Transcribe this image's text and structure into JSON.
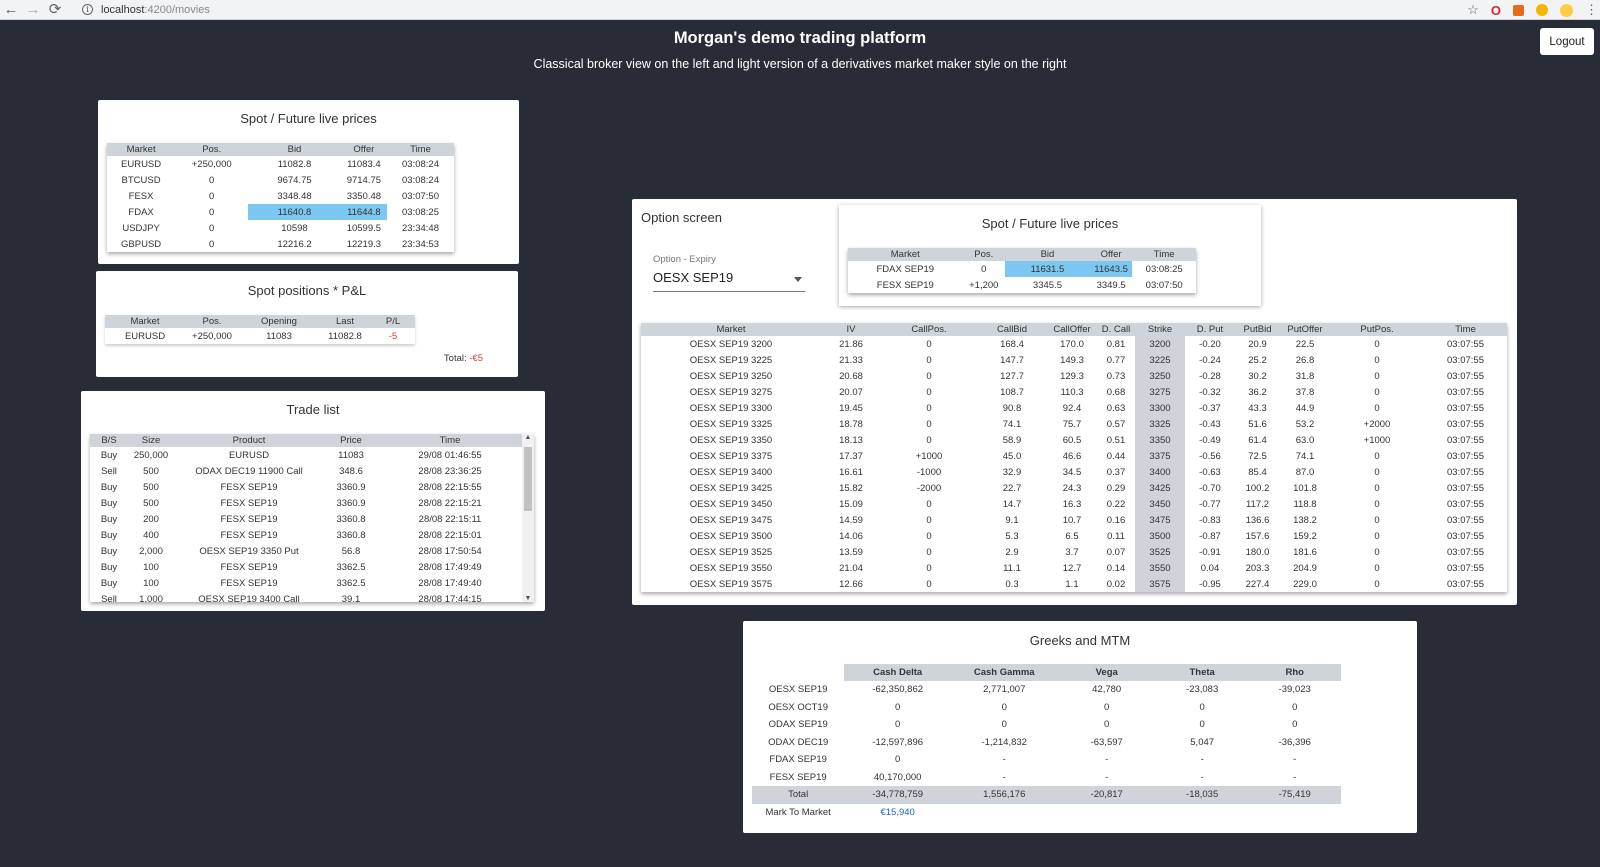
{
  "browser": {
    "url_host": "localhost",
    "url_path": ":4200/movies"
  },
  "header": {
    "title": "Morgan's demo trading platform",
    "subtitle": "Classical broker view on the left and light version of a derivatives market maker style on the right",
    "logout_label": "Logout"
  },
  "spot_prices": {
    "title": "Spot / Future live prices",
    "columns": [
      "Market",
      "Pos.",
      "Bid",
      "Offer",
      "Time"
    ],
    "rows": [
      [
        "EURUSD",
        "+250,000",
        "11082.8",
        "11083.4",
        "03:08:24"
      ],
      [
        "BTCUSD",
        "0",
        "9674.75",
        "9714.75",
        "03:08:24"
      ],
      [
        "FESX",
        "0",
        "3348.48",
        "3350.48",
        "03:07:50"
      ],
      [
        "FDAX",
        "0",
        "11640.8",
        "11644.8",
        "03:08:25"
      ],
      [
        "USDJPY",
        "0",
        "10598",
        "10599.5",
        "23:34:48"
      ],
      [
        "GBPUSD",
        "0",
        "12216.2",
        "12219.3",
        "23:34:53"
      ]
    ]
  },
  "spot_positions": {
    "title": "Spot positions * P&L",
    "columns": [
      "Market",
      "Pos.",
      "Opening",
      "Last",
      "P/L"
    ],
    "rows": [
      [
        "EURUSD",
        "+250,000",
        "11083",
        "11082.8",
        "-5"
      ]
    ],
    "total_label": "Total:",
    "total_value": "-€5"
  },
  "trade_list": {
    "title": "Trade list",
    "columns": [
      "B/S",
      "Size",
      "Product",
      "Price",
      "Time"
    ],
    "rows": [
      [
        "Buy",
        "250,000",
        "EURUSD",
        "11083",
        "29/08 01:46:55"
      ],
      [
        "Sell",
        "500",
        "ODAX DEC19 11900 Call",
        "348.6",
        "28/08 23:36:25"
      ],
      [
        "Buy",
        "500",
        "FESX SEP19",
        "3360.9",
        "28/08 22:15:55"
      ],
      [
        "Buy",
        "500",
        "FESX SEP19",
        "3360.9",
        "28/08 22:15:21"
      ],
      [
        "Buy",
        "200",
        "FESX SEP19",
        "3360.8",
        "28/08 22:15:11"
      ],
      [
        "Buy",
        "400",
        "FESX SEP19",
        "3360.8",
        "28/08 22:15:01"
      ],
      [
        "Buy",
        "2,000",
        "OESX SEP19 3350 Put",
        "56.8",
        "28/08 17:50:54"
      ],
      [
        "Buy",
        "100",
        "FESX SEP19",
        "3362.5",
        "28/08 17:49:49"
      ],
      [
        "Buy",
        "100",
        "FESX SEP19",
        "3362.5",
        "28/08 17:49:40"
      ],
      [
        "Sell",
        "1,000",
        "OESX SEP19 3400 Call",
        "39.1",
        "28/08 17:44:15"
      ]
    ]
  },
  "option_screen": {
    "title": "Option screen",
    "expiry_label": "Option - Expiry",
    "expiry_value": "OESX SEP19",
    "prices_title": "Spot / Future live prices",
    "prices_columns": [
      "Market",
      "Pos.",
      "Bid",
      "Offer",
      "Time"
    ],
    "prices_rows": [
      [
        "FDAX SEP19",
        "0",
        "11631.5",
        "11643.5",
        "03:08:25"
      ],
      [
        "FESX SEP19",
        "+1,200",
        "3345.5",
        "3349.5",
        "03:07:50"
      ]
    ],
    "columns": [
      "Market",
      "IV",
      "CallPos.",
      "CallBid",
      "CallOffer",
      "D. Call",
      "Strike",
      "D. Put",
      "PutBid",
      "PutOffer",
      "PutPos.",
      "Time"
    ],
    "rows": [
      [
        "OESX SEP19 3200",
        "21.86",
        "0",
        "168.4",
        "170.0",
        "0.81",
        "3200",
        "-0.20",
        "20.9",
        "22.5",
        "0",
        "03:07:55"
      ],
      [
        "OESX SEP19 3225",
        "21.33",
        "0",
        "147.7",
        "149.3",
        "0.77",
        "3225",
        "-0.24",
        "25.2",
        "26.8",
        "0",
        "03:07:55"
      ],
      [
        "OESX SEP19 3250",
        "20.68",
        "0",
        "127.7",
        "129.3",
        "0.73",
        "3250",
        "-0.28",
        "30.2",
        "31.8",
        "0",
        "03:07:55"
      ],
      [
        "OESX SEP19 3275",
        "20.07",
        "0",
        "108.7",
        "110.3",
        "0.68",
        "3275",
        "-0.32",
        "36.2",
        "37.8",
        "0",
        "03:07:55"
      ],
      [
        "OESX SEP19 3300",
        "19.45",
        "0",
        "90.8",
        "92.4",
        "0.63",
        "3300",
        "-0.37",
        "43.3",
        "44.9",
        "0",
        "03:07:55"
      ],
      [
        "OESX SEP19 3325",
        "18.78",
        "0",
        "74.1",
        "75.7",
        "0.57",
        "3325",
        "-0.43",
        "51.6",
        "53.2",
        "+2000",
        "03:07:55"
      ],
      [
        "OESX SEP19 3350",
        "18.13",
        "0",
        "58.9",
        "60.5",
        "0.51",
        "3350",
        "-0.49",
        "61.4",
        "63.0",
        "+1000",
        "03:07:55"
      ],
      [
        "OESX SEP19 3375",
        "17.37",
        "+1000",
        "45.0",
        "46.6",
        "0.44",
        "3375",
        "-0.56",
        "72.5",
        "74.1",
        "0",
        "03:07:55"
      ],
      [
        "OESX SEP19 3400",
        "16.61",
        "-1000",
        "32.9",
        "34.5",
        "0.37",
        "3400",
        "-0.63",
        "85.4",
        "87.0",
        "0",
        "03:07:55"
      ],
      [
        "OESX SEP19 3425",
        "15.82",
        "-2000",
        "22.7",
        "24.3",
        "0.29",
        "3425",
        "-0.70",
        "100.2",
        "101.8",
        "0",
        "03:07:55"
      ],
      [
        "OESX SEP19 3450",
        "15.09",
        "0",
        "14.7",
        "16.3",
        "0.22",
        "3450",
        "-0.77",
        "117.2",
        "118.8",
        "0",
        "03:07:55"
      ],
      [
        "OESX SEP19 3475",
        "14.59",
        "0",
        "9.1",
        "10.7",
        "0.16",
        "3475",
        "-0.83",
        "136.6",
        "138.2",
        "0",
        "03:07:55"
      ],
      [
        "OESX SEP19 3500",
        "14.06",
        "0",
        "5.3",
        "6.5",
        "0.11",
        "3500",
        "-0.87",
        "157.6",
        "159.2",
        "0",
        "03:07:55"
      ],
      [
        "OESX SEP19 3525",
        "13.59",
        "0",
        "2.9",
        "3.7",
        "0.07",
        "3525",
        "-0.91",
        "180.0",
        "181.6",
        "0",
        "03:07:55"
      ],
      [
        "OESX SEP19 3550",
        "21.04",
        "0",
        "11.1",
        "12.7",
        "0.14",
        "3550",
        "0.04",
        "203.3",
        "204.9",
        "0",
        "03:07:55"
      ],
      [
        "OESX SEP19 3575",
        "12.66",
        "0",
        "0.3",
        "1.1",
        "0.02",
        "3575",
        "-0.95",
        "227.4",
        "229.0",
        "0",
        "03:07:55"
      ]
    ]
  },
  "greeks": {
    "title": "Greeks and MTM",
    "columns": [
      "",
      "Cash Delta",
      "Cash Gamma",
      "Vega",
      "Theta",
      "Rho"
    ],
    "rows": [
      [
        "OESX SEP19",
        "-62,350,862",
        "2,771,007",
        "42,780",
        "-23,083",
        "-39,023"
      ],
      [
        "OESX OCT19",
        "0",
        "0",
        "0",
        "0",
        "0"
      ],
      [
        "ODAX SEP19",
        "0",
        "0",
        "0",
        "0",
        "0"
      ],
      [
        "ODAX DEC19",
        "-12,597,896",
        "-1,214,832",
        "-63,597",
        "5,047",
        "-36,396"
      ],
      [
        "FDAX SEP19",
        "0",
        "-",
        "-",
        "-",
        "-"
      ],
      [
        "FESX SEP19",
        "40,170,000",
        "-",
        "-",
        "-",
        "-"
      ]
    ],
    "total": [
      "Total",
      "-34,778,759",
      "1,556,176",
      "-20,817",
      "-18,035",
      "-75,419"
    ],
    "mtm_label": "Mark To Market",
    "mtm_value": "€15,940"
  },
  "colors": {
    "background": "#272c36",
    "table_header": "#cfd4db",
    "highlight": "#7cc6f2",
    "negative": "#e53935",
    "link_blue": "#1e63c8"
  }
}
